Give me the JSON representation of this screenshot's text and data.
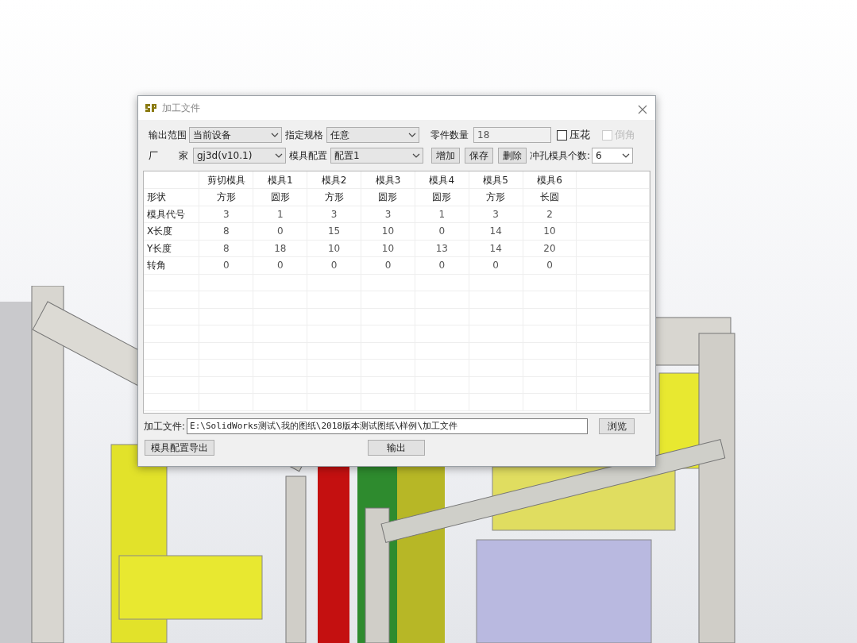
{
  "window": {
    "title": "加工文件"
  },
  "form": {
    "output_range": {
      "label": "输出范围",
      "value": "当前设备"
    },
    "spec": {
      "label": "指定规格",
      "value": "任意"
    },
    "part_count": {
      "label": "零件数量",
      "value": "18"
    },
    "emboss": {
      "label": "压花",
      "checked": false,
      "disabled": false
    },
    "chamfer": {
      "label": "倒角",
      "checked": false,
      "disabled": true
    },
    "vendor": {
      "label_parts": [
        "厂",
        "家"
      ],
      "value": "gj3d(v10.1)"
    },
    "die_config": {
      "label": "模具配置",
      "value": "配置1"
    },
    "buttons": [
      "增加",
      "保存",
      "删除"
    ],
    "punch_count": {
      "label": "冲孔模具个数:",
      "value": "6"
    }
  },
  "table": {
    "columns": [
      "剪切模具",
      "模具1",
      "模具2",
      "模具3",
      "模具4",
      "模具5",
      "模具6"
    ],
    "rows": [
      {
        "label": "形状",
        "cells": [
          "方形",
          "圆形",
          "方形",
          "圆形",
          "圆形",
          "方形",
          "长圆"
        ]
      },
      {
        "label": "模具代号",
        "cells": [
          "3",
          "1",
          "3",
          "3",
          "1",
          "3",
          "2"
        ]
      },
      {
        "label": "X长度",
        "cells": [
          "8",
          "0",
          "15",
          "10",
          "0",
          "14",
          "10"
        ]
      },
      {
        "label": "Y长度",
        "cells": [
          "8",
          "18",
          "10",
          "10",
          "13",
          "14",
          "20"
        ]
      },
      {
        "label": "转角",
        "cells": [
          "0",
          "0",
          "0",
          "0",
          "0",
          "0",
          "0"
        ]
      }
    ]
  },
  "file": {
    "label": "加工文件:",
    "value": "E:\\SolidWorks测试\\我的图纸\\2018版本测试图纸\\样例\\加工文件",
    "browse": "浏览"
  },
  "footer_buttons": [
    {
      "kind": "left",
      "label": "模具配置导出"
    },
    {
      "kind": "center",
      "label": "输出"
    }
  ]
}
